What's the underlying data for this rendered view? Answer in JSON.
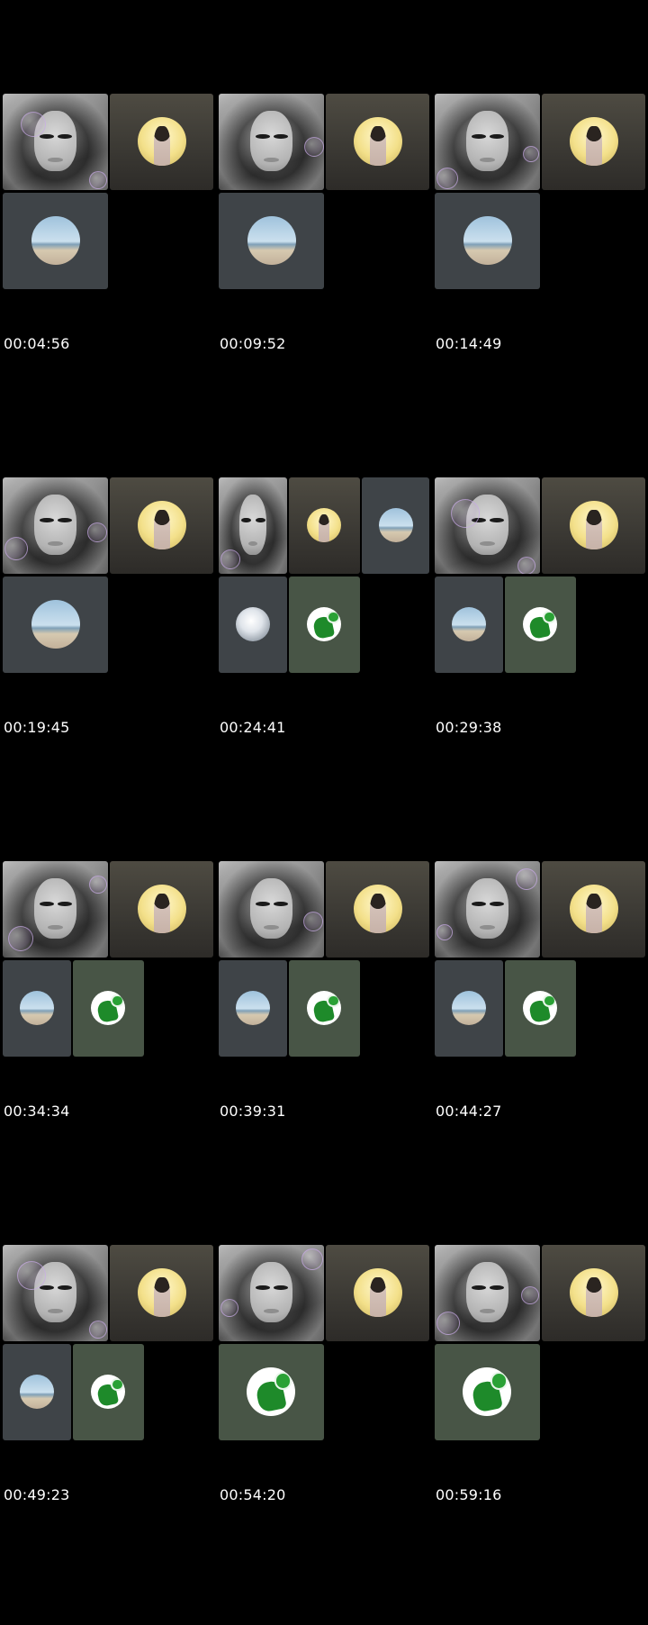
{
  "frames": [
    {
      "timestamp": "00:04:56"
    },
    {
      "timestamp": "00:09:52"
    },
    {
      "timestamp": "00:14:49"
    },
    {
      "timestamp": "00:19:45"
    },
    {
      "timestamp": "00:24:41"
    },
    {
      "timestamp": "00:29:38"
    },
    {
      "timestamp": "00:34:34"
    },
    {
      "timestamp": "00:39:31"
    },
    {
      "timestamp": "00:44:27"
    },
    {
      "timestamp": "00:49:23"
    },
    {
      "timestamp": "00:54:20"
    },
    {
      "timestamp": "00:59:16"
    }
  ],
  "colors": {
    "background": "#000000",
    "timestamp_text": "#ffffff"
  }
}
